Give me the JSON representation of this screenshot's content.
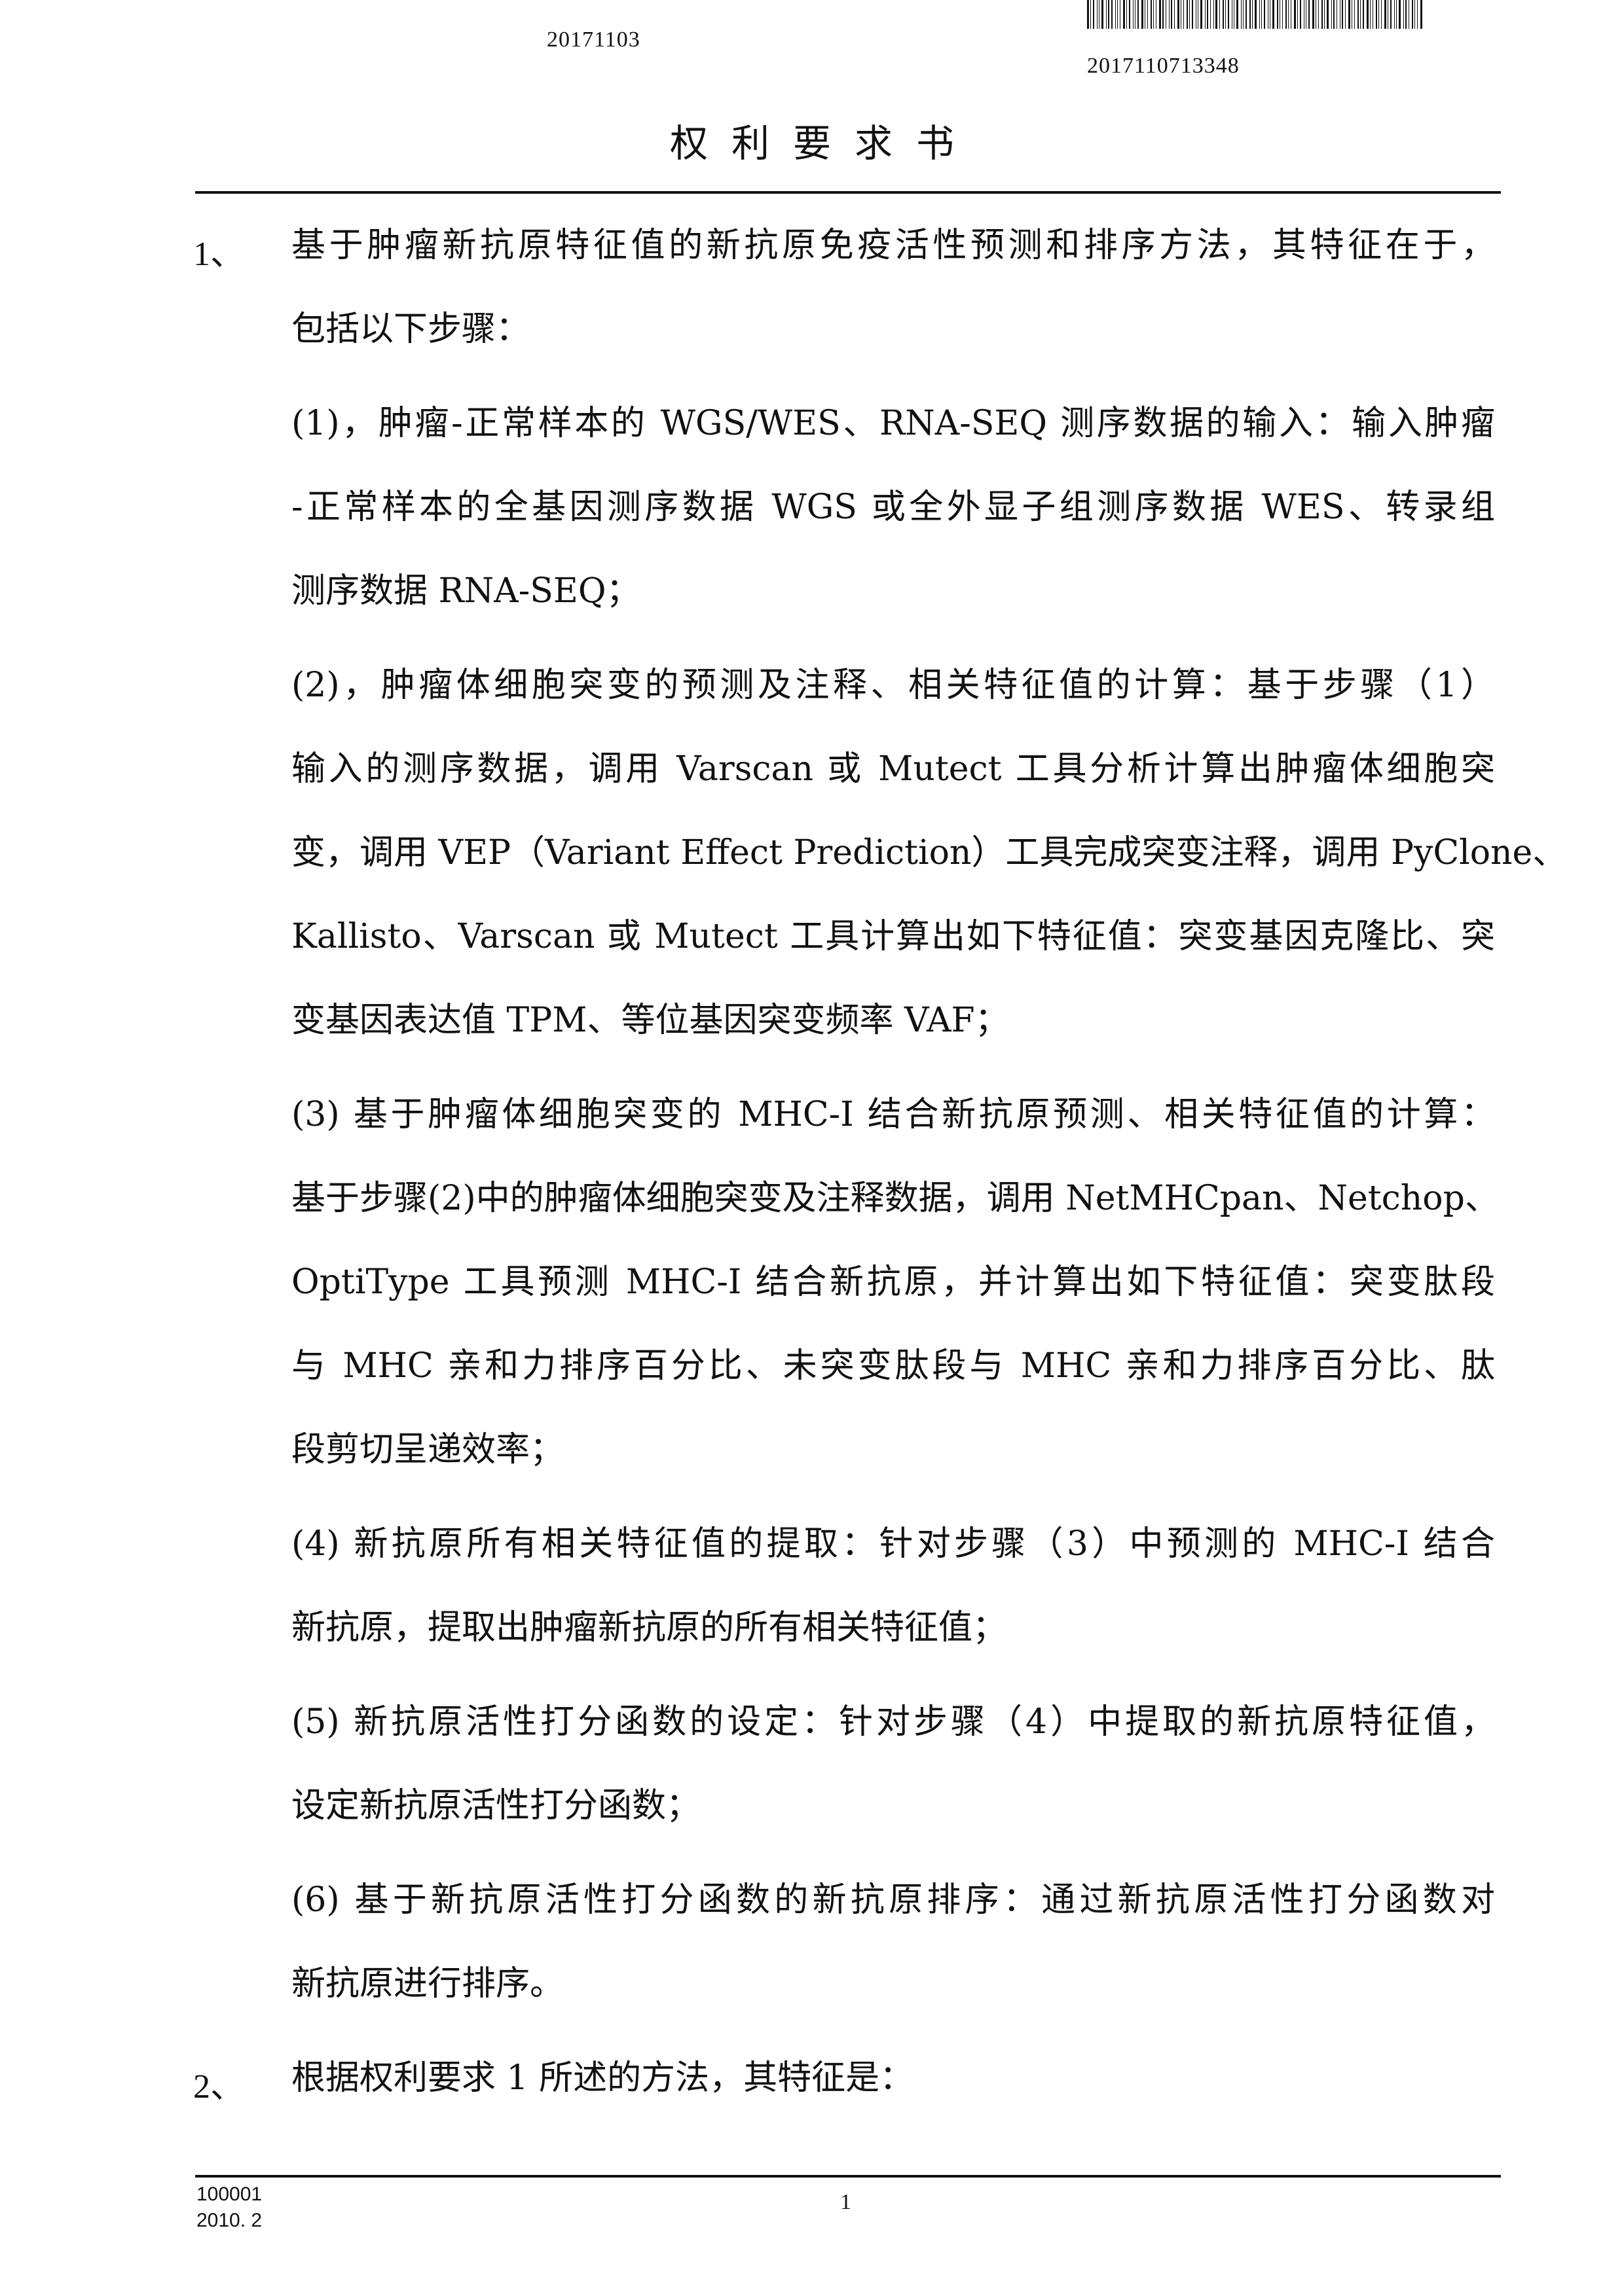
{
  "header": {
    "date": "20171103",
    "barcode_number": "2017110713348"
  },
  "title": "权利要求书",
  "claims": [
    {
      "number": "1、",
      "lines": [
        "基于肿瘤新抗原特征值的新抗原免疫活性预测和排序方法，其特征在于，",
        "包括以下步骤：",
        "(1)，肿瘤-正常样本的 WGS/WES、RNA-SEQ 测序数据的输入：输入肿瘤",
        "-正常样本的全基因测序数据 WGS 或全外显子组测序数据 WES、转录组",
        "测序数据 RNA-SEQ；",
        "(2)，肿瘤体细胞突变的预测及注释、相关特征值的计算：基于步骤（1）",
        "输入的测序数据，调用 Varscan 或 Mutect 工具分析计算出肿瘤体细胞突",
        "变，调用 VEP（Variant Effect Prediction）工具完成突变注释，调用 PyClone、",
        "Kallisto、Varscan 或 Mutect 工具计算出如下特征值：突变基因克隆比、突",
        "变基因表达值 TPM、等位基因突变频率 VAF；",
        "(3) 基于肿瘤体细胞突变的 MHC-I 结合新抗原预测、相关特征值的计算：",
        "基于步骤(2)中的肿瘤体细胞突变及注释数据，调用 NetMHCpan、Netchop、",
        "OptiType 工具预测 MHC-I 结合新抗原，并计算出如下特征值：突变肽段",
        "与 MHC 亲和力排序百分比、未突变肽段与 MHC 亲和力排序百分比、肽",
        "段剪切呈递效率；",
        "(4) 新抗原所有相关特征值的提取：针对步骤（3）中预测的 MHC-I 结合",
        "新抗原，提取出肿瘤新抗原的所有相关特征值；",
        "(5) 新抗原活性打分函数的设定：针对步骤（4）中提取的新抗原特征值，",
        "设定新抗原活性打分函数；",
        "(6) 基于新抗原活性打分函数的新抗原排序：通过新抗原活性打分函数对",
        "新抗原进行排序。"
      ]
    },
    {
      "number": "2、",
      "lines": [
        "根据权利要求 1 所述的方法，其特征是："
      ]
    }
  ],
  "footer": {
    "code_line1": "100001",
    "code_line2": "2010. 2",
    "page_number": "1"
  }
}
